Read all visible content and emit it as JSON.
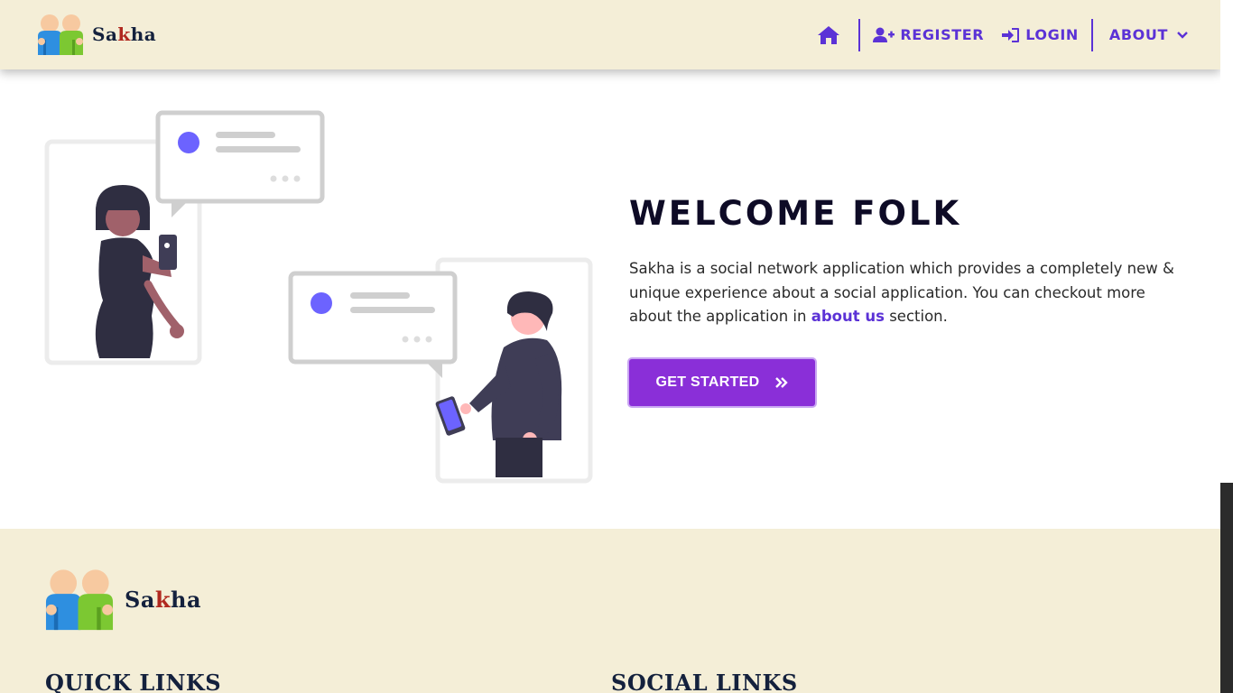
{
  "brand": {
    "name_part1": "Sa",
    "name_k": "k",
    "name_part2": "ha"
  },
  "nav": {
    "home_icon": "home-icon",
    "register": "Register",
    "login": "Login",
    "about": "About"
  },
  "hero": {
    "title": "WELCOME FOLK",
    "text_before": "Sakha is a social network application which provides a completely new & unique experience about a social application. You can checkout more about the application in ",
    "link_text": "about us",
    "text_after": " section.",
    "cta_label": "GET STARTED",
    "cta_icon": "double-chevron-right-icon"
  },
  "footer": {
    "quick_links": "QUICK LINKS",
    "social_links": "SOCIAL LINKS"
  },
  "colors": {
    "nav_bg": "#f4eed7",
    "accent": "#5b32d6",
    "cta": "#8a2fd8",
    "illustration_accent": "#6c63ff"
  }
}
